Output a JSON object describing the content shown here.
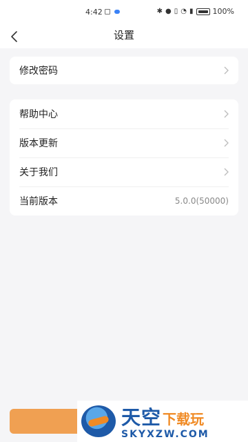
{
  "status_bar": {
    "time": "4:42",
    "battery_pct": "100%"
  },
  "nav": {
    "title": "设置"
  },
  "settings": {
    "group1": [
      {
        "label": "修改密码"
      }
    ],
    "group2": [
      {
        "label": "帮助中心"
      },
      {
        "label": "版本更新"
      },
      {
        "label": "关于我们"
      },
      {
        "label": "当前版本",
        "value": "5.0.0(50000)"
      }
    ]
  },
  "watermark": {
    "title_big": "天空",
    "title_small": "下载玩",
    "url": "SKYXZW.COM"
  },
  "colors": {
    "accent_button": "#f0a052",
    "watermark_blue": "#1e5aa8",
    "watermark_orange": "#f08a24"
  }
}
